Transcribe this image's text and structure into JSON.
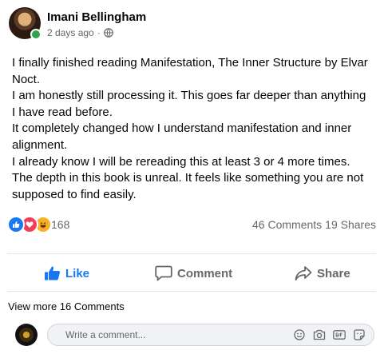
{
  "post": {
    "author": "Imani Bellingham",
    "time": "2 days ago",
    "separator": "·",
    "body": [
      "I finally finished reading Manifestation, The Inner Structure by Elvar Noct.",
      "I am honestly still processing it. This goes far deeper than anything I have read before.",
      "It completely changed how I understand manifestation and inner alignment.",
      "I already know I will be rereading this at least 3 or 4 more times.",
      "The depth in this book is unreal. It feels like something you are not supposed to find easily."
    ]
  },
  "stats": {
    "reaction_count": "168",
    "comments": "46 Comments",
    "shares": "19 Shares"
  },
  "actions": {
    "like": "Like",
    "comment": "Comment",
    "share": "Share"
  },
  "comments_section": {
    "view_more": "View more 16 Comments",
    "placeholder": "Write a comment..."
  },
  "colors": {
    "accent": "#1877f2",
    "love": "#f33e58",
    "haha": "#f7b125",
    "online": "#31a24c",
    "muted": "#65676b"
  },
  "icons": {
    "privacy": "globe-icon",
    "reactions": [
      "like-reaction-icon",
      "love-reaction-icon",
      "haha-reaction-icon"
    ],
    "composer": [
      "emoji-icon",
      "camera-icon",
      "gif-icon",
      "sticker-icon"
    ]
  }
}
